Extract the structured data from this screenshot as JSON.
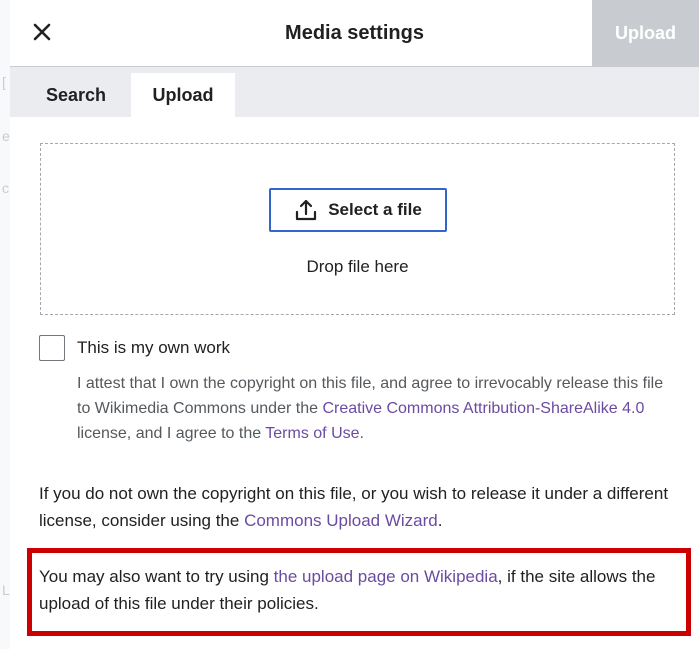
{
  "dialog": {
    "title": "Media settings",
    "upload_action_label": "Upload",
    "close_icon": "close-icon"
  },
  "tabs": [
    {
      "label": "Search",
      "selected": false
    },
    {
      "label": "Upload",
      "selected": true
    }
  ],
  "dropzone": {
    "select_button_label": "Select a file",
    "select_button_icon": "upload-icon",
    "drop_text": "Drop file here"
  },
  "own_work": {
    "checked": false,
    "label": "This is my own work",
    "attest_text_1": "I attest that I own the copyright on this file, and agree to irrevocably release this file to Wikimedia Commons under the ",
    "license_link": "Creative Commons Attribution-ShareAlike 4.0",
    "attest_text_2": " license, and I agree to the ",
    "terms_link": "Terms of Use",
    "attest_text_3": "."
  },
  "not_own_notice": {
    "text_1": "If you do not own the copyright on this file, or you wish to release it under a different license, consider using the ",
    "wizard_link": "Commons Upload Wizard",
    "text_2": "."
  },
  "wikipedia_notice": {
    "text_1": "You may also want to try using ",
    "upload_page_link": "the upload page on Wikipedia",
    "text_2": ", if the site allows the upload of this file under their policies."
  },
  "colors": {
    "link": "#6b4ba1",
    "progressive": "#3366cc",
    "disabled_button_bg": "#c8ccd1",
    "highlight_border": "#cc0000"
  }
}
